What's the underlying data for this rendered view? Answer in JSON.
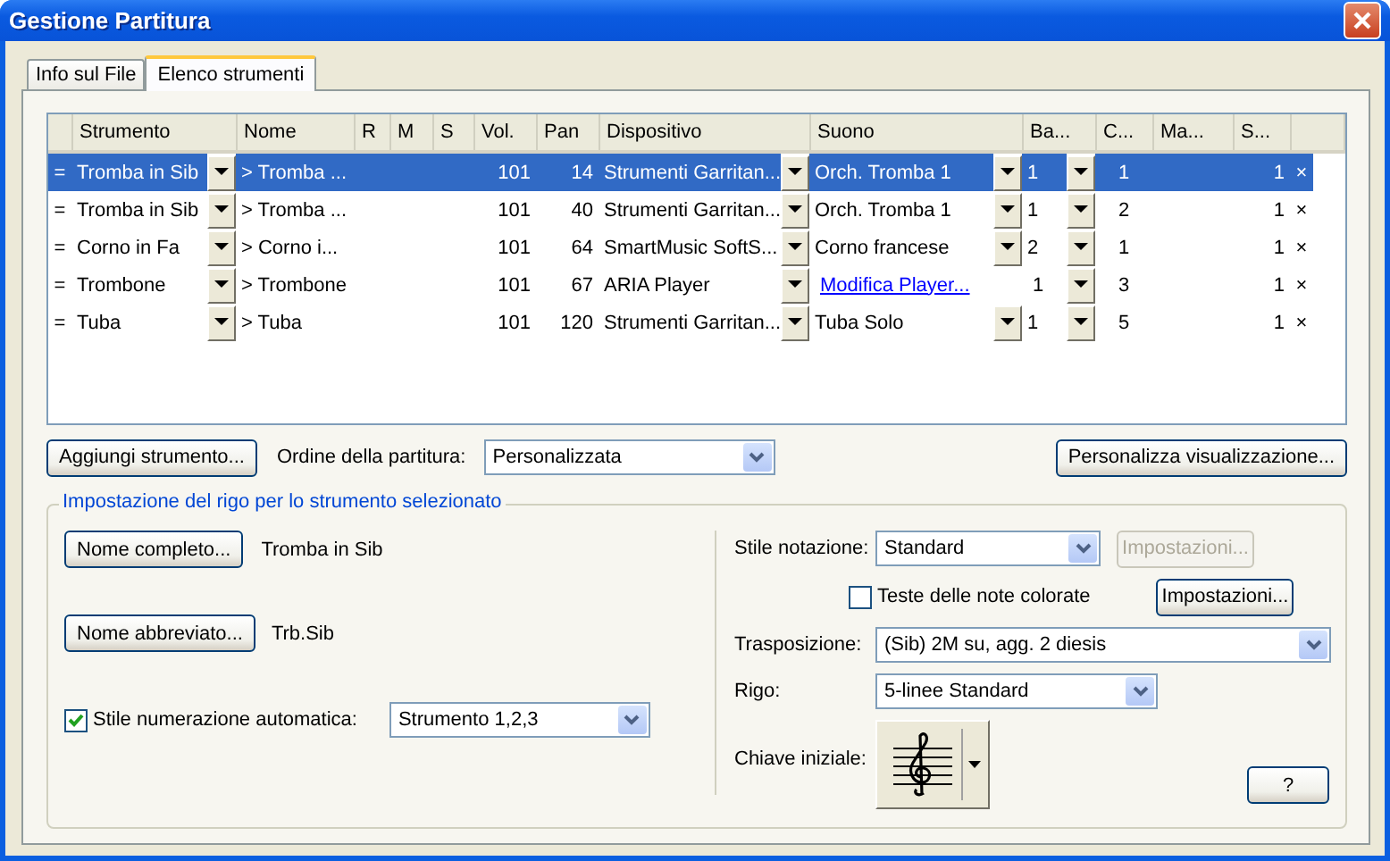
{
  "window": {
    "title": "Gestione Partitura"
  },
  "tabs": [
    {
      "label": "Info sul File",
      "selected": false
    },
    {
      "label": "Elenco strumenti",
      "selected": true
    }
  ],
  "instrument_table": {
    "columns": [
      "Strumento",
      "Nome",
      "R",
      "M",
      "S",
      "Vol.",
      "Pan",
      "Dispositivo",
      "Suono",
      "Ba...",
      "C...",
      "Ma...",
      "S..."
    ],
    "rows": [
      {
        "handle": "=",
        "strumento": "Tromba in Sib",
        "nome": "> Tromba ...",
        "vol": "101",
        "pan": "14",
        "dispositivo": "Strumenti Garritan...",
        "suono": {
          "text": "Orch. Tromba 1",
          "kind": "menu"
        },
        "ba": "1",
        "c": "1",
        "s": "1",
        "remove": "×",
        "selected": true
      },
      {
        "handle": "=",
        "strumento": "Tromba in Sib",
        "nome": "> Tromba ...",
        "vol": "101",
        "pan": "40",
        "dispositivo": "Strumenti Garritan...",
        "suono": {
          "text": "Orch. Tromba 1",
          "kind": "menu"
        },
        "ba": "1",
        "c": "2",
        "s": "1",
        "remove": "×",
        "selected": false
      },
      {
        "handle": "=",
        "strumento": "Corno in Fa",
        "nome": "> Corno i...",
        "vol": "101",
        "pan": "64",
        "dispositivo": "SmartMusic SoftS...",
        "suono": {
          "text": "Corno francese",
          "kind": "menu"
        },
        "ba": "2",
        "c": "1",
        "s": "1",
        "remove": "×",
        "selected": false
      },
      {
        "handle": "=",
        "strumento": "Trombone",
        "nome": "> Trombone",
        "vol": "101",
        "pan": "67",
        "dispositivo": "ARIA Player",
        "suono": {
          "text": "Modifica Player...",
          "kind": "link"
        },
        "ba": "1",
        "c": "3",
        "s": "1",
        "remove": "×",
        "selected": false
      },
      {
        "handle": "=",
        "strumento": "Tuba",
        "nome": "> Tuba",
        "vol": "101",
        "pan": "120",
        "dispositivo": "Strumenti Garritan...",
        "suono": {
          "text": "Tuba Solo",
          "kind": "menu"
        },
        "ba": "1",
        "c": "5",
        "s": "1",
        "remove": "×",
        "selected": false
      }
    ]
  },
  "add_button": "Aggiungi strumento...",
  "score_order": {
    "label": "Ordine della partitura:",
    "value": "Personalizzata"
  },
  "customize_button": "Personalizza visualizzazione...",
  "staff_settings": {
    "title": "Impostazione del rigo per lo strumento selezionato",
    "full_name_button": "Nome completo...",
    "full_name": "Tromba in Sib",
    "short_name_button": "Nome abbreviato...",
    "short_name": "Trb.Sib",
    "auto_numbering": {
      "label": "Stile numerazione automatica:",
      "checked": true,
      "value": "Strumento 1,2,3"
    },
    "notation_style": {
      "label": "Stile notazione:",
      "value": "Standard",
      "settings_button": "Impostazioni...",
      "settings_disabled": true
    },
    "colored_noteheads": {
      "label": "Teste delle note colorate",
      "checked": false,
      "settings_button": "Impostazioni...",
      "settings_disabled": false
    },
    "transposition": {
      "label": "Trasposizione:",
      "value": "(Sib) 2M su, agg. 2 diesis"
    },
    "staff": {
      "label": "Rigo:",
      "value": "5-linee Standard"
    },
    "initial_clef": {
      "label": "Chiave iniziale:"
    },
    "help_button": "?"
  }
}
